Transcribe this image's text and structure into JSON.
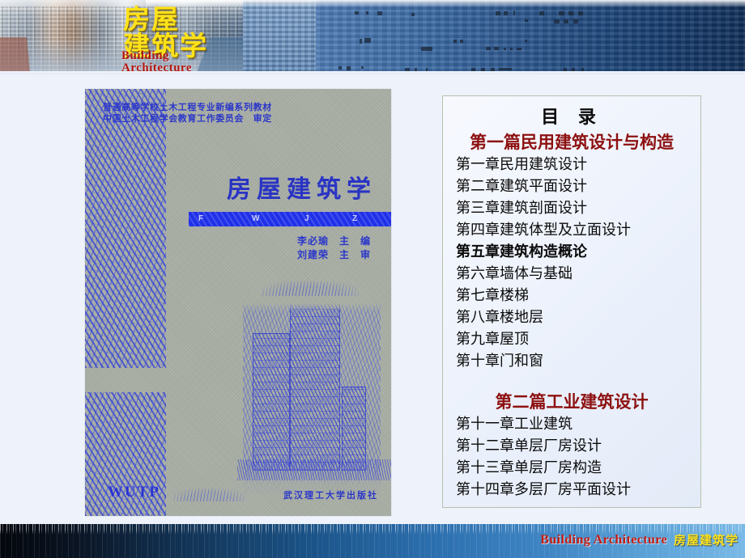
{
  "header": {
    "title_cn": "房屋\n建筑学",
    "title_en": "Building\nArchitecture",
    "colors": {
      "title_cn": "#ffe21a",
      "title_en": "#b3160f"
    }
  },
  "book_cover": {
    "line1": "普通高等学校土木工程专业新编系列教材",
    "line2": "中国土木工程学会教育工作委员会　审定",
    "main_title": "房屋建筑学",
    "band_letters": [
      "F",
      "W",
      "J",
      "Z"
    ],
    "editor": "李必瑜　主　编",
    "reviewer": "刘建荣　主　审",
    "imprint_logo": "WUTP",
    "publisher": "武汉理工大学出版社",
    "colors": {
      "ink": "#2b37c9",
      "band": "#1f30e8",
      "paper": "#aab0a6"
    }
  },
  "toc": {
    "title": "目 录",
    "part1": {
      "heading": "第一篇民用建筑设计与构造",
      "chapters": [
        {
          "label": "第一章民用建筑设计",
          "bold": false
        },
        {
          "label": "第二章建筑平面设计",
          "bold": false
        },
        {
          "label": "第三章建筑剖面设计",
          "bold": false
        },
        {
          "label": "第四章建筑体型及立面设计",
          "bold": false
        },
        {
          "label": "第五章建筑构造概论",
          "bold": true
        },
        {
          "label": "第六章墙体与基础",
          "bold": false
        },
        {
          "label": "第七章楼梯",
          "bold": false
        },
        {
          "label": "第八章楼地层",
          "bold": false
        },
        {
          "label": "第九章屋顶",
          "bold": false
        },
        {
          "label": "第十章门和窗",
          "bold": false
        }
      ]
    },
    "part2": {
      "heading": "第二篇工业建筑设计",
      "chapters": [
        {
          "label": "第十一章工业建筑",
          "bold": false
        },
        {
          "label": "第十二章单层厂房设计",
          "bold": false
        },
        {
          "label": "第十三章单层厂房构造",
          "bold": false
        },
        {
          "label": "第十四章多层厂房平面设计",
          "bold": false
        }
      ]
    },
    "colors": {
      "title": "#0a0a0a",
      "part_heading": "#8d1010",
      "chapter": "#0b0b0b"
    }
  },
  "footer": {
    "title_en": "Building Architecture",
    "title_cn": "房屋建筑学",
    "colors": {
      "title_en": "#c41b12",
      "title_cn": "#ffe21a"
    }
  }
}
